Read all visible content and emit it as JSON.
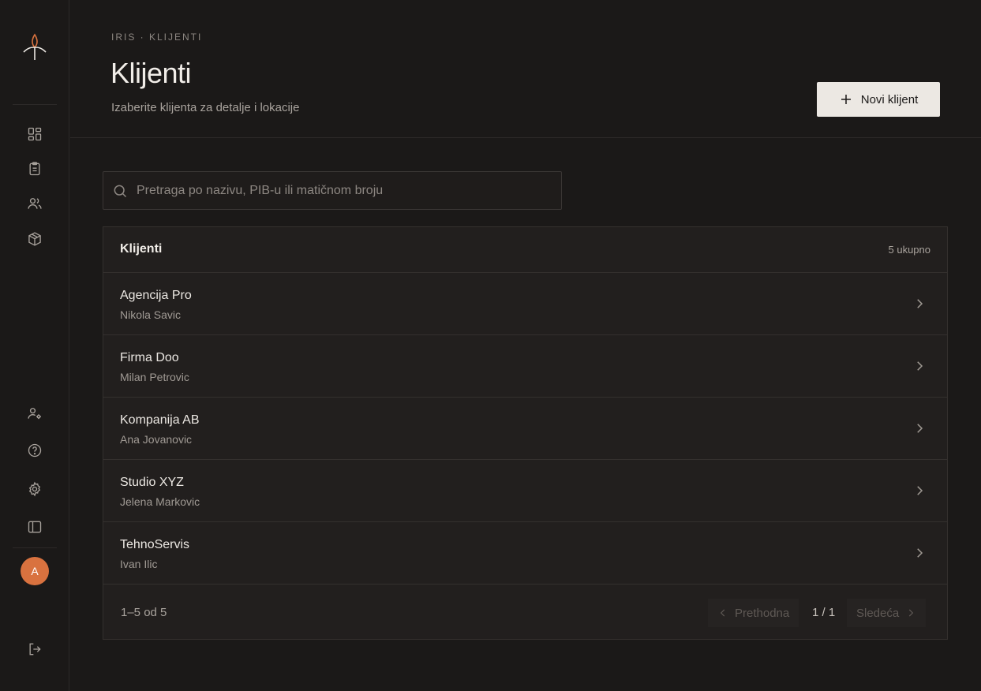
{
  "sidebar": {
    "logo": "iris-logo",
    "nav": [
      {
        "name": "dashboard-icon"
      },
      {
        "name": "clipboard-icon"
      },
      {
        "name": "users-icon"
      },
      {
        "name": "package-icon"
      }
    ],
    "bottom": [
      {
        "name": "user-settings-icon"
      },
      {
        "name": "help-icon"
      },
      {
        "name": "gear-icon"
      },
      {
        "name": "sidebar-toggle-icon"
      }
    ],
    "avatar_initial": "A",
    "logout": "logout-icon"
  },
  "header": {
    "breadcrumb": "IRIS · KLIJENTI",
    "title": "Klijenti",
    "subtitle": "Izaberite klijenta za detalje i lokacije",
    "new_button": "Novi klijent"
  },
  "search": {
    "placeholder": "Pretraga po nazivu, PIB-u ili matičnom broju",
    "value": ""
  },
  "list": {
    "title": "Klijenti",
    "count": "5 ukupno",
    "rows": [
      {
        "name": "Agencija Pro",
        "contact": "Nikola Savic"
      },
      {
        "name": "Firma Doo",
        "contact": "Milan Petrovic"
      },
      {
        "name": "Kompanija AB",
        "contact": "Ana Jovanovic"
      },
      {
        "name": "Studio XYZ",
        "contact": "Jelena Markovic"
      },
      {
        "name": "TehnoServis",
        "contact": "Ivan Ilic"
      }
    ]
  },
  "pagination": {
    "range": "1–5 od 5",
    "prev": "Prethodna",
    "page": "1 / 1",
    "next": "Sledeća"
  },
  "colors": {
    "background": "#1b1918",
    "panel": "#221f1e",
    "accent": "#d9723f",
    "primary_button": "#ece8e3"
  }
}
